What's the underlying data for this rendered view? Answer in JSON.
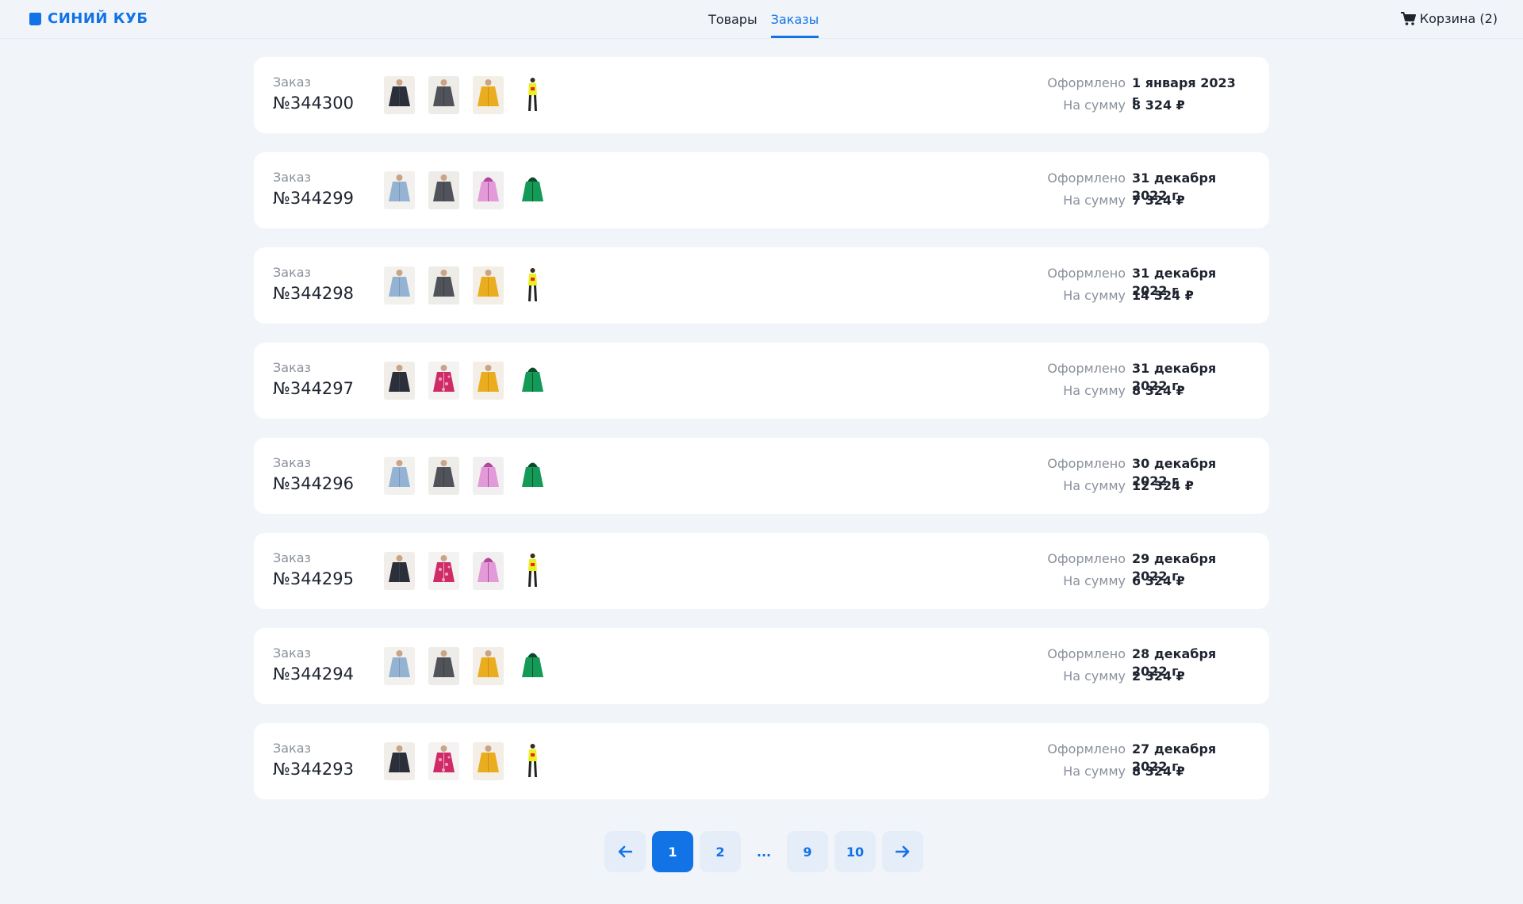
{
  "header": {
    "logo_text": "СИНИЙ КУБ",
    "logo_icon": "cube-logo-icon",
    "nav": [
      {
        "label": "Товары",
        "active": false
      },
      {
        "label": "Заказы",
        "active": true
      }
    ],
    "cart_label": "Корзина (2)",
    "cart_icon": "cart-icon"
  },
  "colors": {
    "accent": "#1273e6",
    "page_bg": "#f1f5fa",
    "card_bg": "#ffffff",
    "muted_text": "#8a919c"
  },
  "order_label": "Заказ",
  "placed_label": "Оформлено",
  "sum_label": "На сумму",
  "orders": [
    {
      "number": "№344300",
      "date": "1 января 2023 г",
      "sum": "8 324 ₽",
      "items": [
        "dark-jacket",
        "grey-jacket",
        "yellow-jacket",
        "yellow-girl-jacket"
      ]
    },
    {
      "number": "№344299",
      "date": "31 декабря 2022 г",
      "sum": "7 324 ₽",
      "items": [
        "denim-jacket",
        "grey-jacket",
        "pink-jacket",
        "green-jacket"
      ]
    },
    {
      "number": "№344298",
      "date": "31 декабря 2022 г",
      "sum": "14 324 ₽",
      "items": [
        "denim-jacket",
        "grey-jacket",
        "yellow-jacket",
        "yellow-girl-jacket"
      ]
    },
    {
      "number": "№344297",
      "date": "31 декабря 2022 г",
      "sum": "8 324 ₽",
      "items": [
        "dark-jacket",
        "floral-jacket",
        "yellow-jacket",
        "green-jacket"
      ]
    },
    {
      "number": "№344296",
      "date": "30 декабря 2022 г",
      "sum": "12 324 ₽",
      "items": [
        "denim-jacket",
        "grey-jacket",
        "pink-jacket",
        "green-jacket"
      ]
    },
    {
      "number": "№344295",
      "date": "29 декабря 2022 г",
      "sum": "6 324 ₽",
      "items": [
        "dark-jacket",
        "floral-jacket",
        "pink-jacket",
        "yellow-girl-jacket"
      ]
    },
    {
      "number": "№344294",
      "date": "28 декабря 2022 г",
      "sum": "2 324 ₽",
      "items": [
        "denim-jacket",
        "grey-jacket",
        "yellow-jacket",
        "green-jacket"
      ]
    },
    {
      "number": "№344293",
      "date": "27 декабря 2022 г",
      "sum": "8 324 ₽",
      "items": [
        "dark-jacket",
        "floral-jacket",
        "yellow-jacket",
        "yellow-girl-jacket"
      ]
    }
  ],
  "pagination": {
    "prev_icon": "arrow-left-icon",
    "next_icon": "arrow-right-icon",
    "pages": [
      "1",
      "2"
    ],
    "ellipsis": "...",
    "last_pages": [
      "9",
      "10"
    ],
    "current": "1"
  }
}
